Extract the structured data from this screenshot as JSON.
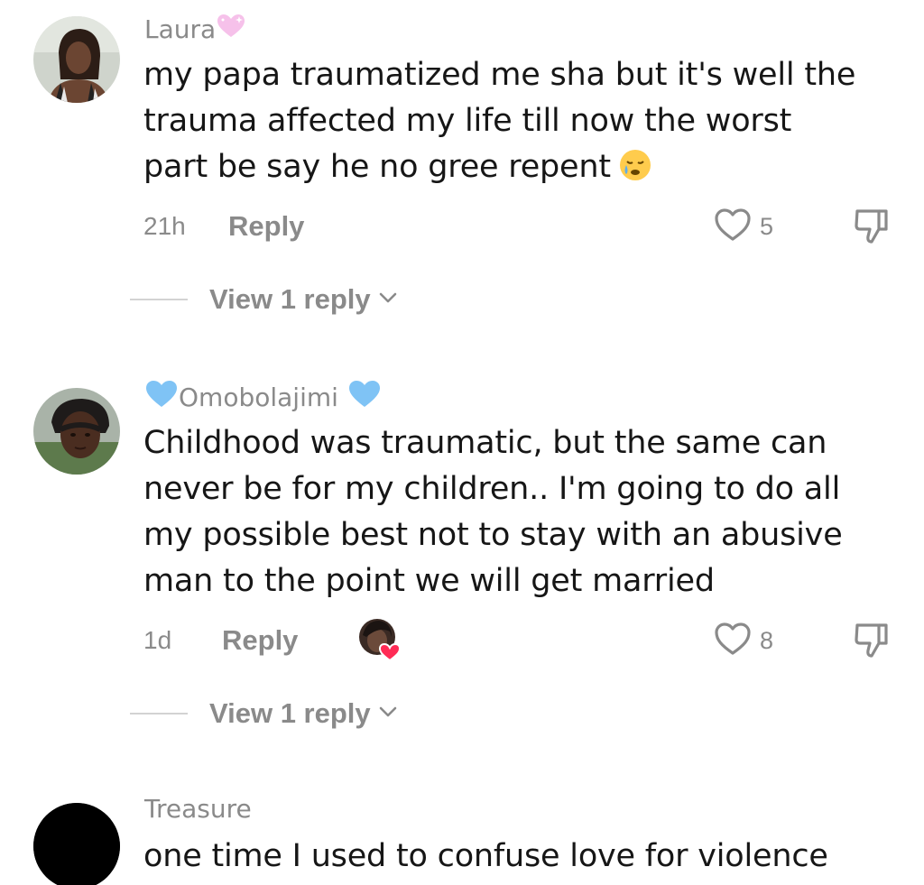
{
  "comments": [
    {
      "username": "Laura",
      "username_emoji": "sparkling-heart",
      "lines": [
        "my papa traumatized me sha but it's well the",
        "trauma affected my life till now the worst",
        "part be say he no gree repent"
      ],
      "trailing_emoji": "crying-face",
      "time": "21h",
      "reply_label": "Reply",
      "likes": "5",
      "view_replies_label": "View 1 reply"
    },
    {
      "username": "Omobolajimi",
      "username_emoji": "light-blue-heart",
      "lines": [
        "Childhood was traumatic, but the same can",
        "never be for my children.. I'm going to do all",
        "my possible best not to stay with an abusive",
        "man to the point we will get married"
      ],
      "time": "1d",
      "reply_label": "Reply",
      "liked_by_creator": true,
      "likes": "8",
      "view_replies_label": "View 1 reply"
    },
    {
      "username": "Treasure",
      "lines": [
        "one time I used to confuse love for violence"
      ]
    }
  ],
  "colors": {
    "meta_gray": "#8a8a8a",
    "text": "#161616",
    "heart_pink": "#f6c1ea",
    "heart_blue": "#7fc3f5",
    "creator_heart": "#ff2b55"
  }
}
